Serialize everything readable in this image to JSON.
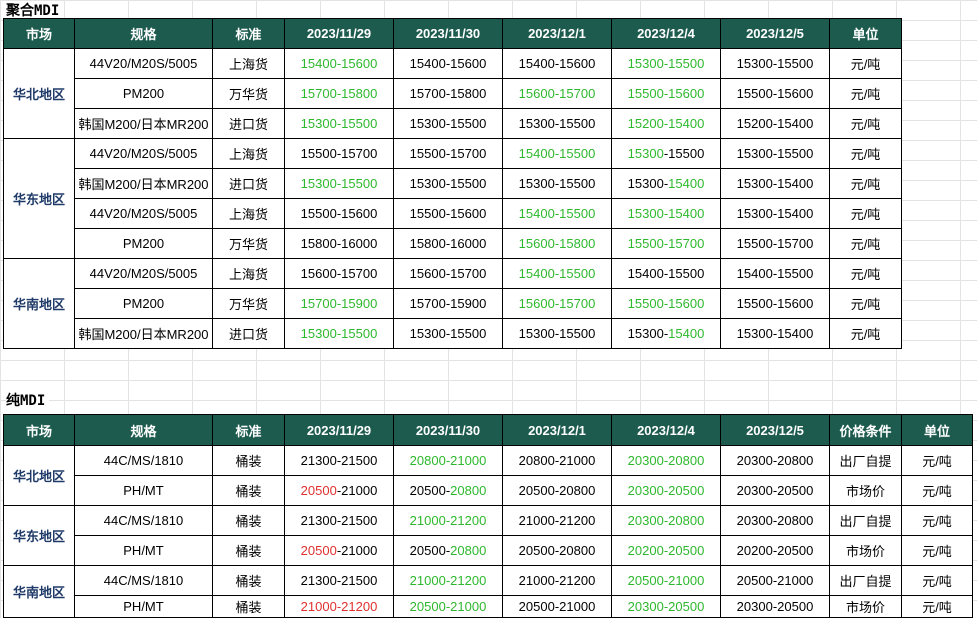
{
  "sections": [
    {
      "title": "聚合MDI",
      "headers": [
        "市场",
        "规格",
        "标准",
        "2023/11/29",
        "2023/11/30",
        "2023/12/1",
        "2023/12/4",
        "2023/12/5",
        "单位"
      ],
      "groups": [
        {
          "region": "华北地区",
          "rows": [
            {
              "spec": "44V20/M20S/5005",
              "standard": "上海货",
              "prices": [
                {
                  "low": "15400",
                  "high": "15600",
                  "lc": "g",
                  "hc": "g"
                },
                {
                  "low": "15400",
                  "high": "15600",
                  "lc": "k",
                  "hc": "k"
                },
                {
                  "low": "15400",
                  "high": "15600",
                  "lc": "k",
                  "hc": "k"
                },
                {
                  "low": "15300",
                  "high": "15500",
                  "lc": "g",
                  "hc": "g"
                },
                {
                  "low": "15300",
                  "high": "15500",
                  "lc": "k",
                  "hc": "k"
                }
              ],
              "extra": [],
              "unit": "元/吨"
            },
            {
              "spec": "PM200",
              "standard": "万华货",
              "prices": [
                {
                  "low": "15700",
                  "high": "15800",
                  "lc": "g",
                  "hc": "g"
                },
                {
                  "low": "15700",
                  "high": "15800",
                  "lc": "k",
                  "hc": "k"
                },
                {
                  "low": "15600",
                  "high": "15700",
                  "lc": "g",
                  "hc": "g"
                },
                {
                  "low": "15500",
                  "high": "15600",
                  "lc": "g",
                  "hc": "g"
                },
                {
                  "low": "15500",
                  "high": "15600",
                  "lc": "k",
                  "hc": "k"
                }
              ],
              "extra": [],
              "unit": "元/吨"
            },
            {
              "spec": "韩国M200/日本MR200",
              "standard": "进口货",
              "prices": [
                {
                  "low": "15300",
                  "high": "15500",
                  "lc": "g",
                  "hc": "g"
                },
                {
                  "low": "15300",
                  "high": "15500",
                  "lc": "k",
                  "hc": "k"
                },
                {
                  "low": "15300",
                  "high": "15500",
                  "lc": "k",
                  "hc": "k"
                },
                {
                  "low": "15200",
                  "high": "15400",
                  "lc": "g",
                  "hc": "g"
                },
                {
                  "low": "15200",
                  "high": "15400",
                  "lc": "k",
                  "hc": "k"
                }
              ],
              "extra": [],
              "unit": "元/吨"
            }
          ]
        },
        {
          "region": "华东地区",
          "rows": [
            {
              "spec": "44V20/M20S/5005",
              "standard": "上海货",
              "prices": [
                {
                  "low": "15500",
                  "high": "15700",
                  "lc": "k",
                  "hc": "k"
                },
                {
                  "low": "15500",
                  "high": "15700",
                  "lc": "k",
                  "hc": "k"
                },
                {
                  "low": "15400",
                  "high": "15500",
                  "lc": "g",
                  "hc": "g"
                },
                {
                  "low": "15300",
                  "high": "15500",
                  "lc": "g",
                  "hc": "k"
                },
                {
                  "low": "15300",
                  "high": "15500",
                  "lc": "k",
                  "hc": "k"
                }
              ],
              "extra": [],
              "unit": "元/吨"
            },
            {
              "spec": "韩国M200/日本MR200",
              "standard": "进口货",
              "prices": [
                {
                  "low": "15300",
                  "high": "15500",
                  "lc": "g",
                  "hc": "g"
                },
                {
                  "low": "15300",
                  "high": "15500",
                  "lc": "k",
                  "hc": "k"
                },
                {
                  "low": "15300",
                  "high": "15500",
                  "lc": "k",
                  "hc": "k"
                },
                {
                  "low": "15300",
                  "high": "15400",
                  "lc": "k",
                  "hc": "g"
                },
                {
                  "low": "15300",
                  "high": "15400",
                  "lc": "k",
                  "hc": "k"
                }
              ],
              "extra": [],
              "unit": "元/吨"
            },
            {
              "spec": "44V20/M20S/5005",
              "standard": "上海货",
              "prices": [
                {
                  "low": "15500",
                  "high": "15600",
                  "lc": "k",
                  "hc": "k"
                },
                {
                  "low": "15500",
                  "high": "15600",
                  "lc": "k",
                  "hc": "k"
                },
                {
                  "low": "15400",
                  "high": "15500",
                  "lc": "g",
                  "hc": "g"
                },
                {
                  "low": "15300",
                  "high": "15400",
                  "lc": "g",
                  "hc": "g"
                },
                {
                  "low": "15300",
                  "high": "15400",
                  "lc": "k",
                  "hc": "k"
                }
              ],
              "extra": [],
              "unit": "元/吨"
            },
            {
              "spec": "PM200",
              "standard": "万华货",
              "prices": [
                {
                  "low": "15800",
                  "high": "16000",
                  "lc": "k",
                  "hc": "k"
                },
                {
                  "low": "15800",
                  "high": "16000",
                  "lc": "k",
                  "hc": "k"
                },
                {
                  "low": "15600",
                  "high": "15800",
                  "lc": "g",
                  "hc": "g"
                },
                {
                  "low": "15500",
                  "high": "15700",
                  "lc": "g",
                  "hc": "g"
                },
                {
                  "low": "15500",
                  "high": "15700",
                  "lc": "k",
                  "hc": "k"
                }
              ],
              "extra": [],
              "unit": "元/吨"
            }
          ]
        },
        {
          "region": "华南地区",
          "rows": [
            {
              "spec": "44V20/M20S/5005",
              "standard": "上海货",
              "prices": [
                {
                  "low": "15600",
                  "high": "15700",
                  "lc": "k",
                  "hc": "k"
                },
                {
                  "low": "15600",
                  "high": "15700",
                  "lc": "k",
                  "hc": "k"
                },
                {
                  "low": "15400",
                  "high": "15500",
                  "lc": "g",
                  "hc": "g"
                },
                {
                  "low": "15400",
                  "high": "15500",
                  "lc": "k",
                  "hc": "k"
                },
                {
                  "low": "15400",
                  "high": "15500",
                  "lc": "k",
                  "hc": "k"
                }
              ],
              "extra": [],
              "unit": "元/吨"
            },
            {
              "spec": "PM200",
              "standard": "万华货",
              "prices": [
                {
                  "low": "15700",
                  "high": "15900",
                  "lc": "g",
                  "hc": "g"
                },
                {
                  "low": "15700",
                  "high": "15900",
                  "lc": "k",
                  "hc": "k"
                },
                {
                  "low": "15600",
                  "high": "15700",
                  "lc": "g",
                  "hc": "g"
                },
                {
                  "low": "15500",
                  "high": "15600",
                  "lc": "g",
                  "hc": "g"
                },
                {
                  "low": "15500",
                  "high": "15600",
                  "lc": "k",
                  "hc": "k"
                }
              ],
              "extra": [],
              "unit": "元/吨"
            },
            {
              "spec": "韩国M200/日本MR200",
              "standard": "进口货",
              "prices": [
                {
                  "low": "15300",
                  "high": "15500",
                  "lc": "g",
                  "hc": "g"
                },
                {
                  "low": "15300",
                  "high": "15500",
                  "lc": "k",
                  "hc": "k"
                },
                {
                  "low": "15300",
                  "high": "15500",
                  "lc": "k",
                  "hc": "k"
                },
                {
                  "low": "15300",
                  "high": "15400",
                  "lc": "k",
                  "hc": "g"
                },
                {
                  "low": "15300",
                  "high": "15400",
                  "lc": "k",
                  "hc": "k"
                }
              ],
              "extra": [],
              "unit": "元/吨"
            }
          ]
        }
      ]
    },
    {
      "title": "纯MDI",
      "headers": [
        "市场",
        "规格",
        "标准",
        "2023/11/29",
        "2023/11/30",
        "2023/12/1",
        "2023/12/4",
        "2023/12/5",
        "价格条件",
        "单位"
      ],
      "groups": [
        {
          "region": "华北地区",
          "rows": [
            {
              "spec": "44C/MS/1810",
              "standard": "桶装",
              "prices": [
                {
                  "low": "21300",
                  "high": "21500",
                  "lc": "k",
                  "hc": "k"
                },
                {
                  "low": "20800",
                  "high": "21000",
                  "lc": "g",
                  "hc": "g"
                },
                {
                  "low": "20800",
                  "high": "21000",
                  "lc": "k",
                  "hc": "k"
                },
                {
                  "low": "20300",
                  "high": "20800",
                  "lc": "g",
                  "hc": "g"
                },
                {
                  "low": "20300",
                  "high": "20800",
                  "lc": "k",
                  "hc": "k"
                }
              ],
              "extra": [
                "出厂自提"
              ],
              "unit": "元/吨"
            },
            {
              "spec": "PH/MT",
              "standard": "桶装",
              "prices": [
                {
                  "low": "20500",
                  "high": "21000",
                  "lc": "r",
                  "hc": "k"
                },
                {
                  "low": "20500",
                  "high": "20800",
                  "lc": "k",
                  "hc": "g"
                },
                {
                  "low": "20500",
                  "high": "20800",
                  "lc": "k",
                  "hc": "k"
                },
                {
                  "low": "20300",
                  "high": "20500",
                  "lc": "g",
                  "hc": "g"
                },
                {
                  "low": "20300",
                  "high": "20500",
                  "lc": "k",
                  "hc": "k"
                }
              ],
              "extra": [
                "市场价"
              ],
              "unit": "元/吨"
            }
          ]
        },
        {
          "region": "华东地区",
          "rows": [
            {
              "spec": "44C/MS/1810",
              "standard": "桶装",
              "prices": [
                {
                  "low": "21300",
                  "high": "21500",
                  "lc": "k",
                  "hc": "k"
                },
                {
                  "low": "21000",
                  "high": "21200",
                  "lc": "g",
                  "hc": "g"
                },
                {
                  "low": "21000",
                  "high": "21200",
                  "lc": "k",
                  "hc": "k"
                },
                {
                  "low": "20300",
                  "high": "20800",
                  "lc": "g",
                  "hc": "g"
                },
                {
                  "low": "20300",
                  "high": "20800",
                  "lc": "k",
                  "hc": "k"
                }
              ],
              "extra": [
                "出厂自提"
              ],
              "unit": "元/吨"
            },
            {
              "spec": "PH/MT",
              "standard": "桶装",
              "prices": [
                {
                  "low": "20500",
                  "high": "21000",
                  "lc": "r",
                  "hc": "k"
                },
                {
                  "low": "20500",
                  "high": "20800",
                  "lc": "k",
                  "hc": "g"
                },
                {
                  "low": "20500",
                  "high": "20800",
                  "lc": "k",
                  "hc": "k"
                },
                {
                  "low": "20200",
                  "high": "20500",
                  "lc": "g",
                  "hc": "g"
                },
                {
                  "low": "20200",
                  "high": "20500",
                  "lc": "k",
                  "hc": "k"
                }
              ],
              "extra": [
                "市场价"
              ],
              "unit": "元/吨"
            }
          ]
        },
        {
          "region": "华南地区",
          "rows": [
            {
              "spec": "44C/MS/1810",
              "standard": "桶装",
              "prices": [
                {
                  "low": "21300",
                  "high": "21500",
                  "lc": "k",
                  "hc": "k"
                },
                {
                  "low": "21000",
                  "high": "21200",
                  "lc": "g",
                  "hc": "g"
                },
                {
                  "low": "21000",
                  "high": "21200",
                  "lc": "k",
                  "hc": "k"
                },
                {
                  "low": "20500",
                  "high": "21000",
                  "lc": "g",
                  "hc": "g"
                },
                {
                  "low": "20500",
                  "high": "21000",
                  "lc": "k",
                  "hc": "k"
                }
              ],
              "extra": [
                "出厂自提"
              ],
              "unit": "元/吨"
            },
            {
              "spec": "PH/MT",
              "standard": "桶装",
              "prices": [
                {
                  "low": "21000",
                  "high": "21200",
                  "lc": "r",
                  "hc": "r"
                },
                {
                  "low": "20500",
                  "high": "21000",
                  "lc": "g",
                  "hc": "g"
                },
                {
                  "low": "20500",
                  "high": "21000",
                  "lc": "k",
                  "hc": "k"
                },
                {
                  "low": "20300",
                  "high": "20500",
                  "lc": "g",
                  "hc": "g"
                },
                {
                  "low": "20300",
                  "high": "20500",
                  "lc": "k",
                  "hc": "k"
                }
              ],
              "extra": [
                "市场价"
              ],
              "unit": "元/吨"
            }
          ]
        }
      ]
    }
  ]
}
